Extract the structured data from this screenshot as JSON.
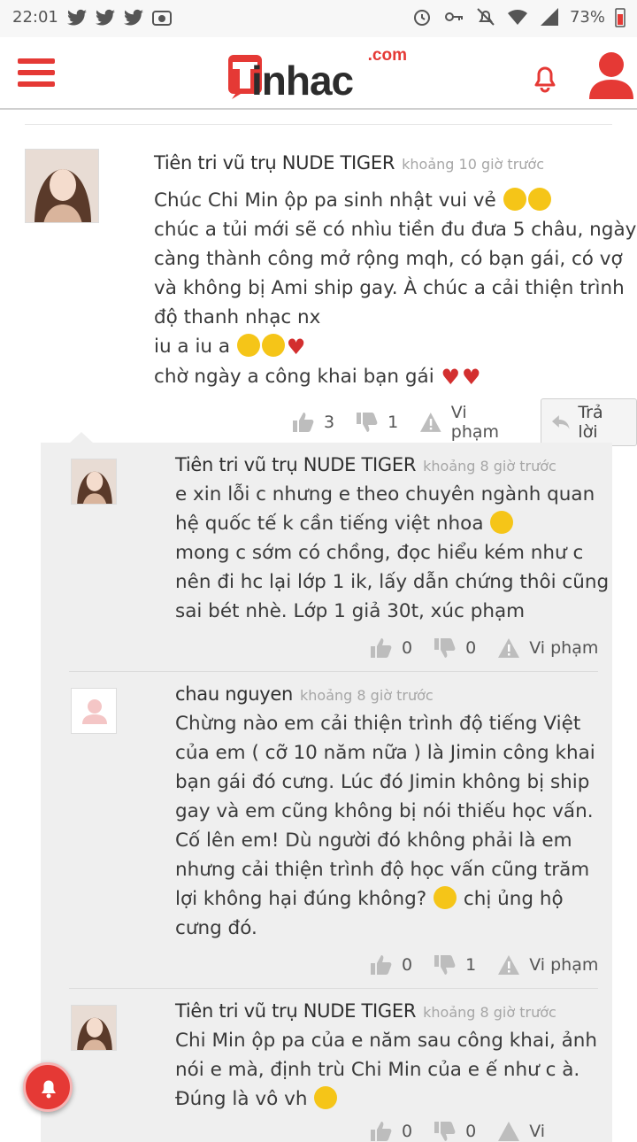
{
  "status_bar": {
    "time": "22:01",
    "battery": "73%",
    "left_icons": [
      "twitter-icon",
      "twitter-icon",
      "twitter-icon",
      "photo-icon"
    ],
    "right_icons": [
      "alarm-icon",
      "key-icon",
      "mute-icon",
      "wifi-icon",
      "signal-icon",
      "battery-icon"
    ]
  },
  "header": {
    "logo_text": "inhac",
    "logo_domain": ".com",
    "brand_color": "#e53935"
  },
  "comments": [
    {
      "author": "Tiên tri vũ trụ NUDE TIGER",
      "time": "khoảng 10 giờ trước",
      "lines": [
        "Chúc Chi Min ộp pa sinh nhật vui vẻ",
        "chúc a tủi mới sẽ có nhìu tiền đu đưa 5 châu, ngày",
        "càng thành công mở rộng mqh, có bạn gái, có vợ",
        "và không bị Ami ship gay. À chúc a cải thiện trình",
        "độ thanh nhạc nx",
        "iu a iu a",
        "chờ ngày a công khai bạn gái"
      ],
      "likes": "3",
      "dislikes": "1",
      "report": "Vi phạm",
      "reply": "Trả lời"
    }
  ],
  "replies": [
    {
      "author": "Tiên tri vũ trụ NUDE TIGER",
      "time": "khoảng 8 giờ trước",
      "lines": [
        "e xin lỗi c nhưng e theo chuyên ngành quan",
        "hệ quốc tế k cần tiếng việt nhoa",
        "mong c sớm có chồng, đọc hiểu kém như c",
        "nên đi hc lại lớp 1 ik, lấy dẫn chứng thôi cũng",
        "sai bét nhè. Lớp 1 giả 30t, xúc phạm"
      ],
      "likes": "0",
      "dislikes": "0",
      "report": "Vi phạm"
    },
    {
      "author": "chau nguyen",
      "time": "khoảng 8 giờ trước",
      "lines": [
        "Chừng nào em cải thiện trình độ tiếng Việt",
        "của em ( cỡ 10 năm nữa ) là Jimin công khai",
        "bạn gái đó cưng. Lúc đó Jimin không bị ship",
        "gay và em cũng không bị nói thiếu học vấn.",
        "Cố lên em! Dù người đó không phải là em",
        "nhưng cải thiện trình độ học vấn cũng trăm",
        "lợi không hại đúng không?",
        "cưng đó."
      ],
      "line7_suffix": "chị ủng hộ",
      "likes": "0",
      "dislikes": "1",
      "report": "Vi phạm"
    },
    {
      "author": "Tiên tri vũ trụ NUDE TIGER",
      "time": "khoảng 8 giờ trước",
      "lines": [
        "Chi Min ộp pa của e năm sau công khai, ảnh",
        "nói e mà, định trù Chi Min của e ế như c à.",
        "Đúng là vô vh"
      ],
      "likes": "0",
      "dislikes": "0",
      "report": "Vi"
    }
  ]
}
